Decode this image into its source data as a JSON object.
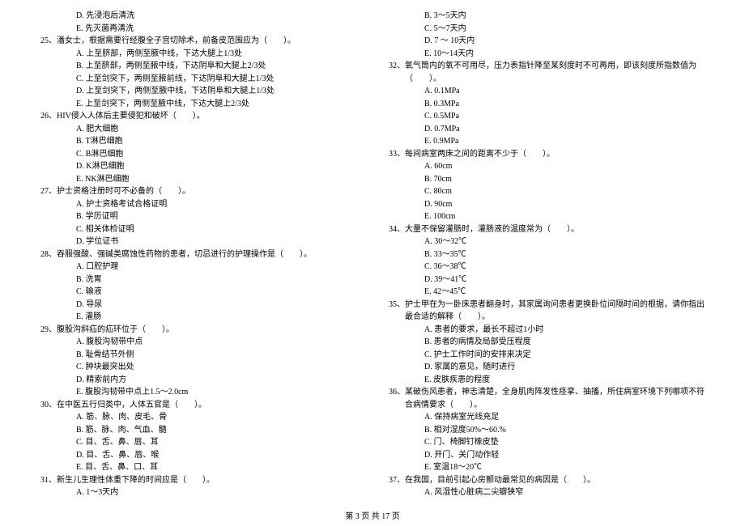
{
  "footer": "第 3 页 共 17 页",
  "left": [
    {
      "cls": "opt",
      "text": "D. 先浸泡后清洗"
    },
    {
      "cls": "opt",
      "text": "E. 先灭菌再清洗"
    },
    {
      "cls": "q",
      "text": "25、潘女士，根据需要行经腹全子宫切除术，前备皮范围应为（　　）。"
    },
    {
      "cls": "opt",
      "text": "A.  上至脐部，两侧至腋中线，下达大腿上1/3处"
    },
    {
      "cls": "opt",
      "text": "B.  上至脐部，两侧至腋中线，下达阴阜和大腿上2/3处"
    },
    {
      "cls": "opt",
      "text": "C.  上至剑突下，两侧至腋前线，下达阴阜和大腿上1/3处"
    },
    {
      "cls": "opt",
      "text": "D.  上至剑突下，两侧至腋中线，下达阴阜和大腿上1/3处"
    },
    {
      "cls": "opt",
      "text": "E.  上至剑突下，两侧至腋中线，下达大腿上2/3处"
    },
    {
      "cls": "q",
      "text": "26、HIV侵入人体后主要侵犯和破坏（　　）。"
    },
    {
      "cls": "opt",
      "text": "A. 肥大细胞"
    },
    {
      "cls": "opt",
      "text": "B. T淋巴细胞"
    },
    {
      "cls": "opt",
      "text": "C. B淋巴细胞"
    },
    {
      "cls": "opt",
      "text": "D. K淋巴细胞"
    },
    {
      "cls": "opt",
      "text": "E. NK淋巴细胞"
    },
    {
      "cls": "q",
      "text": "27、护士资格注册时可不必备的（　　）。"
    },
    {
      "cls": "opt",
      "text": "A. 护士资格考试合格证明"
    },
    {
      "cls": "opt",
      "text": "B. 学历证明"
    },
    {
      "cls": "opt",
      "text": "C. 相关体检证明"
    },
    {
      "cls": "opt",
      "text": "D. 学位证书"
    },
    {
      "cls": "q",
      "text": "28、吞服强酸、强碱类腐蚀性药物的患者，切忌进行的护理操作是（　　）。"
    },
    {
      "cls": "opt",
      "text": "A. 口腔护理"
    },
    {
      "cls": "opt",
      "text": "B. 洗胃"
    },
    {
      "cls": "opt",
      "text": "C. 输液"
    },
    {
      "cls": "opt",
      "text": "D. 导尿"
    },
    {
      "cls": "opt",
      "text": "E. 灌肠"
    },
    {
      "cls": "q",
      "text": "29、腹股沟斜疝的疝环位于（　　）。"
    },
    {
      "cls": "opt",
      "text": "A. 腹股沟韧带中点"
    },
    {
      "cls": "opt",
      "text": "B. 耻骨结节外侧"
    },
    {
      "cls": "opt",
      "text": "C. 肿块最突出处"
    },
    {
      "cls": "opt",
      "text": "D. 精索前内方"
    },
    {
      "cls": "opt",
      "text": "E. 腹股沟韧带中点上1.5～2.0cm"
    },
    {
      "cls": "q",
      "text": "30、在中医五行归类中，人体五官是（　　）。"
    },
    {
      "cls": "opt",
      "text": "A. 筋、脉、肉、皮毛、骨"
    },
    {
      "cls": "opt",
      "text": "B. 筋、脉、肉、气血、髓"
    },
    {
      "cls": "opt",
      "text": "C. 目、舌、鼻、唇、耳"
    },
    {
      "cls": "opt",
      "text": "D. 目、舌、鼻、唇、喉"
    },
    {
      "cls": "opt",
      "text": "E. 目、舌、鼻、口、耳"
    },
    {
      "cls": "q",
      "text": "31、新生儿生理性体重下降的时间应是（　　）。"
    },
    {
      "cls": "opt",
      "text": "A. 1～3天内"
    }
  ],
  "right": [
    {
      "cls": "opt",
      "text": "B. 3～5天内"
    },
    {
      "cls": "opt",
      "text": "C. 5～7天内"
    },
    {
      "cls": "opt",
      "text": "D. 7 ～ 10天内"
    },
    {
      "cls": "opt",
      "text": "E. 10～14天内"
    },
    {
      "cls": "q",
      "text": "32、氧气筒内的氧不可用尽，压力表指针降至某刻度时不可再用，即该刻度所指数值为（　　）。"
    },
    {
      "cls": "opt",
      "text": "A. 0.1MPa"
    },
    {
      "cls": "opt",
      "text": "B. 0.3MPa"
    },
    {
      "cls": "opt",
      "text": "C. 0.5MPa"
    },
    {
      "cls": "opt",
      "text": "D. 0.7MPa"
    },
    {
      "cls": "opt",
      "text": "E. 0.9MPa"
    },
    {
      "cls": "q",
      "text": "33、每间病室两床之间的距离不少于（　　）。"
    },
    {
      "cls": "opt",
      "text": "A.  60cm"
    },
    {
      "cls": "opt",
      "text": "B.  70cm"
    },
    {
      "cls": "opt",
      "text": "C.  80cm"
    },
    {
      "cls": "opt",
      "text": "D.  90cm"
    },
    {
      "cls": "opt",
      "text": "E.  100cm"
    },
    {
      "cls": "q",
      "text": "34、大量不保留灌肠时，灌肠液的温度常为（　　）。"
    },
    {
      "cls": "opt",
      "text": "A.  30～32℃"
    },
    {
      "cls": "opt",
      "text": "B.  33～35℃"
    },
    {
      "cls": "opt",
      "text": "C.  36～38℃"
    },
    {
      "cls": "opt",
      "text": "D.  39～41℃"
    },
    {
      "cls": "opt",
      "text": "E.  42～45℃"
    },
    {
      "cls": "q",
      "text": "35、护士甲在为一卧床患者翻身时，其家属询问患者更换卧位间隔时间的根据，请你指出最合适的解释（　　）。"
    },
    {
      "cls": "opt",
      "text": "A. 患者的要求，最长不超过1小时"
    },
    {
      "cls": "opt",
      "text": "B. 患者的病情及局部受压程度"
    },
    {
      "cls": "opt",
      "text": "C. 护士工作时间的安排来决定"
    },
    {
      "cls": "opt",
      "text": "D. 家属的意见，随时进行"
    },
    {
      "cls": "opt",
      "text": "E. 皮肤疾患的程度"
    },
    {
      "cls": "q",
      "text": "36、某破伤风患者，神志清楚，全身肌肉阵发性痉挛、抽搐，所住病室环境下列哪项不符合病情要求（　　）。"
    },
    {
      "cls": "opt",
      "text": "A.  保持病室光线充足"
    },
    {
      "cls": "opt",
      "text": "B.  相对湿度50%～60.%"
    },
    {
      "cls": "opt",
      "text": "C.  门、椅脚钉橡皮垫"
    },
    {
      "cls": "opt",
      "text": "D.  开门、关门动作轻"
    },
    {
      "cls": "opt",
      "text": "E.  室温18～20℃"
    },
    {
      "cls": "q",
      "text": "37、在我国，目前引起心房颤动最常见的病因是（　　）。"
    },
    {
      "cls": "opt",
      "text": "A. 风湿性心脏病二尖瓣狭窄"
    }
  ]
}
